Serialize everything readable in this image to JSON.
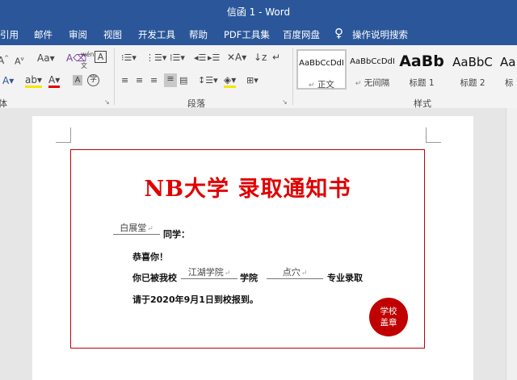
{
  "window": {
    "title": "信函 1  -  Word"
  },
  "menu": [
    "引用",
    "邮件",
    "审阅",
    "视图",
    "开发工具",
    "帮助",
    "PDF工具集",
    "百度网盘",
    "操作说明搜索"
  ],
  "ribbon": {
    "font_group_label": "体",
    "paragraph_group_label": "段落",
    "styles_group_label": "样式",
    "styles": [
      {
        "sample": "AaBbCcDdI",
        "name": "正文",
        "mark": "↵"
      },
      {
        "sample": "AaBbCcDdI",
        "name": "无间隔",
        "mark": "↵"
      },
      {
        "sample": "AaBb",
        "name": "标题 1",
        "mark": ""
      },
      {
        "sample": "AaBbC",
        "name": "标题 2",
        "mark": ""
      },
      {
        "sample": "Aa",
        "name": "标",
        "mark": ""
      }
    ]
  },
  "letter": {
    "heading": "NB大学 录取通知书",
    "student_name": "白展堂",
    "salutation": "同学：",
    "congrats": "恭喜你！",
    "admitted_prefix": "你已被我校",
    "college": "江湖学院",
    "college_suffix": "学院",
    "major": "点穴",
    "major_suffix": "专业录取",
    "report": "请于2020年9月1日到校报到。",
    "para_mark": "↵",
    "seal_line1": "学校",
    "seal_line2": "盖章"
  },
  "colors": {
    "accent": "#2b579a",
    "heading": "#e00000",
    "seal": "#c00000",
    "frame": "#c00000"
  }
}
